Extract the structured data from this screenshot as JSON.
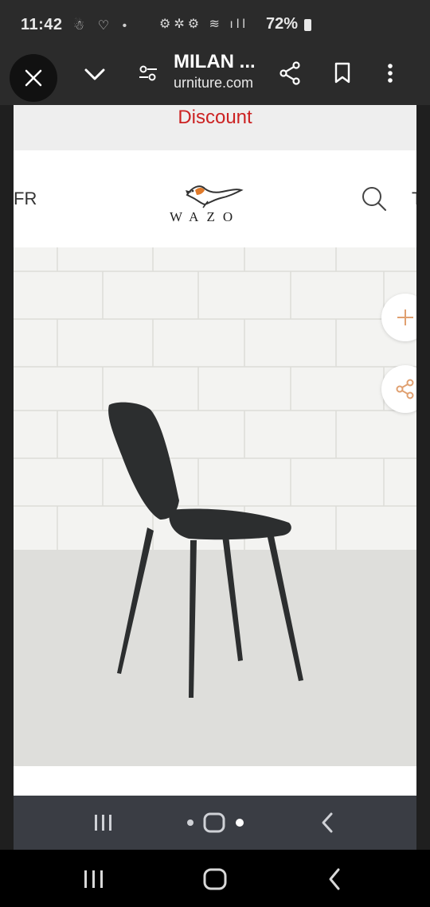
{
  "status_bar": {
    "time": "11:42",
    "notification_icons": "☃ ♡ •",
    "system_icons": "⚙✲⚙ ≋ ıll",
    "battery": "72%"
  },
  "toolbar": {
    "title": "MILAN ...",
    "url": "urniture.com"
  },
  "page": {
    "promo_text": "Discount",
    "language": "FR",
    "logo_text": "WAZO",
    "cart_glyph": "T"
  },
  "colors": {
    "promo_text": "#cc2222",
    "fab_accent": "#e0a070",
    "logo_orange": "#e07a2a"
  }
}
